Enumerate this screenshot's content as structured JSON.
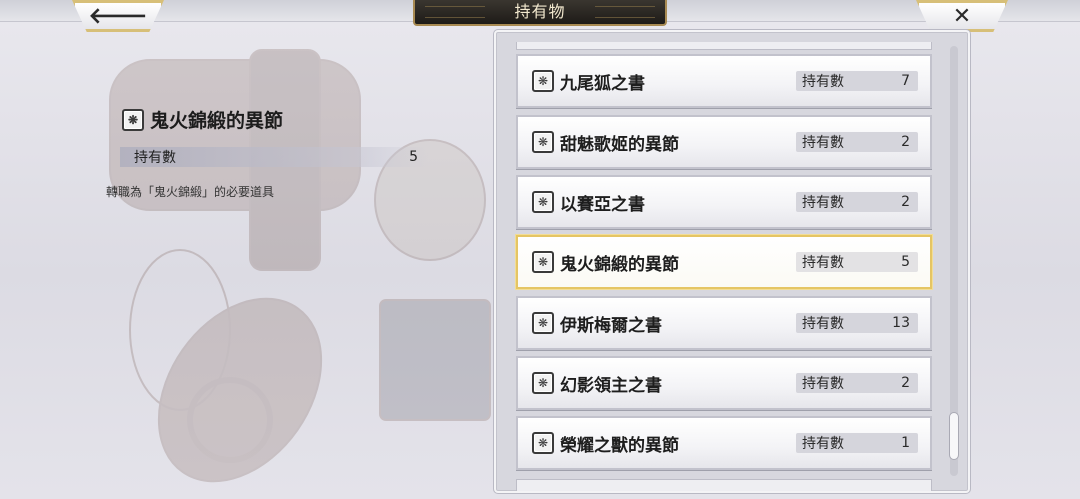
{
  "header": {
    "title": "持有物",
    "back_icon": "left-arrow-icon",
    "back_glyph": "🡐",
    "close_icon": "close-icon",
    "close_glyph": "✕"
  },
  "detail": {
    "icon": "book-icon",
    "icon_glyph": "❋",
    "name": "鬼火錦緞的異節",
    "count_label": "持有數",
    "count_value": "5",
    "description": "轉職為「鬼火錦緞」的必要道具"
  },
  "items": [
    {
      "name": "九尾狐之書",
      "count_label": "持有數",
      "count": "7",
      "selected": false
    },
    {
      "name": "甜魅歌姬的異節",
      "count_label": "持有數",
      "count": "2",
      "selected": false
    },
    {
      "name": "以賽亞之書",
      "count_label": "持有數",
      "count": "2",
      "selected": false
    },
    {
      "name": "鬼火錦緞的異節",
      "count_label": "持有數",
      "count": "5",
      "selected": true
    },
    {
      "name": "伊斯梅爾之書",
      "count_label": "持有數",
      "count": "13",
      "selected": false
    },
    {
      "name": "幻影領主之書",
      "count_label": "持有數",
      "count": "2",
      "selected": false
    },
    {
      "name": "榮耀之獸的異節",
      "count_label": "持有數",
      "count": "1",
      "selected": false
    }
  ],
  "item_icon": "book-icon",
  "item_icon_glyph": "❋",
  "colors": {
    "selected_border": "#e5c564",
    "title_plate": "#1e1b17",
    "title_text": "#f3e9cf",
    "corner_border": "#d7bf78"
  }
}
